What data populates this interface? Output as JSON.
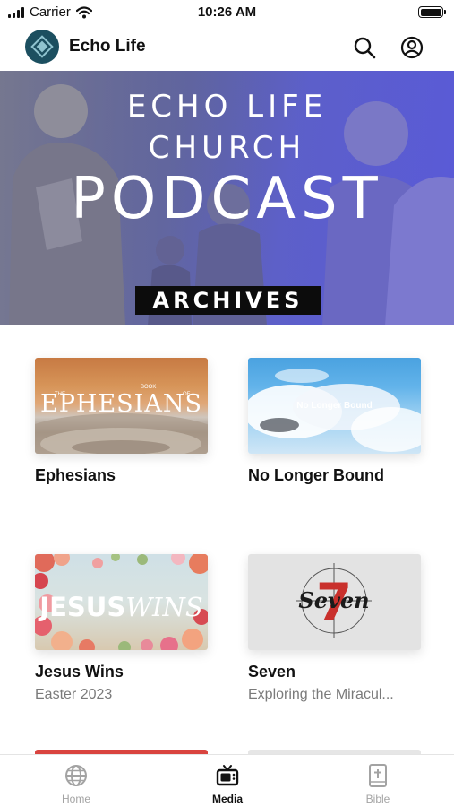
{
  "status_bar": {
    "carrier": "Carrier",
    "time": "10:26 AM"
  },
  "app_bar": {
    "title": "Echo Life",
    "logo_icon": "echo-life-logo",
    "search_icon": "search-icon",
    "account_icon": "account-icon"
  },
  "hero": {
    "line1": "ECHO LIFE",
    "line2": "CHURCH",
    "line3": "PODCAST",
    "badge": "ARCHIVES"
  },
  "series": [
    {
      "title": "Ephesians",
      "subtitle": "",
      "art_main": "EPHESIANS",
      "art_small_left": "THE",
      "art_small_mid": "BOOK",
      "art_small_right": "OF"
    },
    {
      "title": "No Longer Bound",
      "subtitle": "",
      "art_main": "No Longer Bound"
    },
    {
      "title": "Jesus Wins",
      "subtitle": "Easter 2023",
      "art_main_a": "JESUS",
      "art_main_b": "WINS"
    },
    {
      "title": "Seven",
      "subtitle": "Exploring the Miracul...",
      "art_number": "7",
      "art_word": "Seven"
    }
  ],
  "tab_bar": {
    "active": "Media",
    "tabs": [
      {
        "label": "Home",
        "icon": "globe-icon"
      },
      {
        "label": "Media",
        "icon": "tv-icon"
      },
      {
        "label": "Bible",
        "icon": "bible-icon"
      }
    ]
  },
  "colors": {
    "hero_tint": "#5a5ad8",
    "active_tab": "#111111",
    "inactive_tab": "#a3a3a3"
  }
}
